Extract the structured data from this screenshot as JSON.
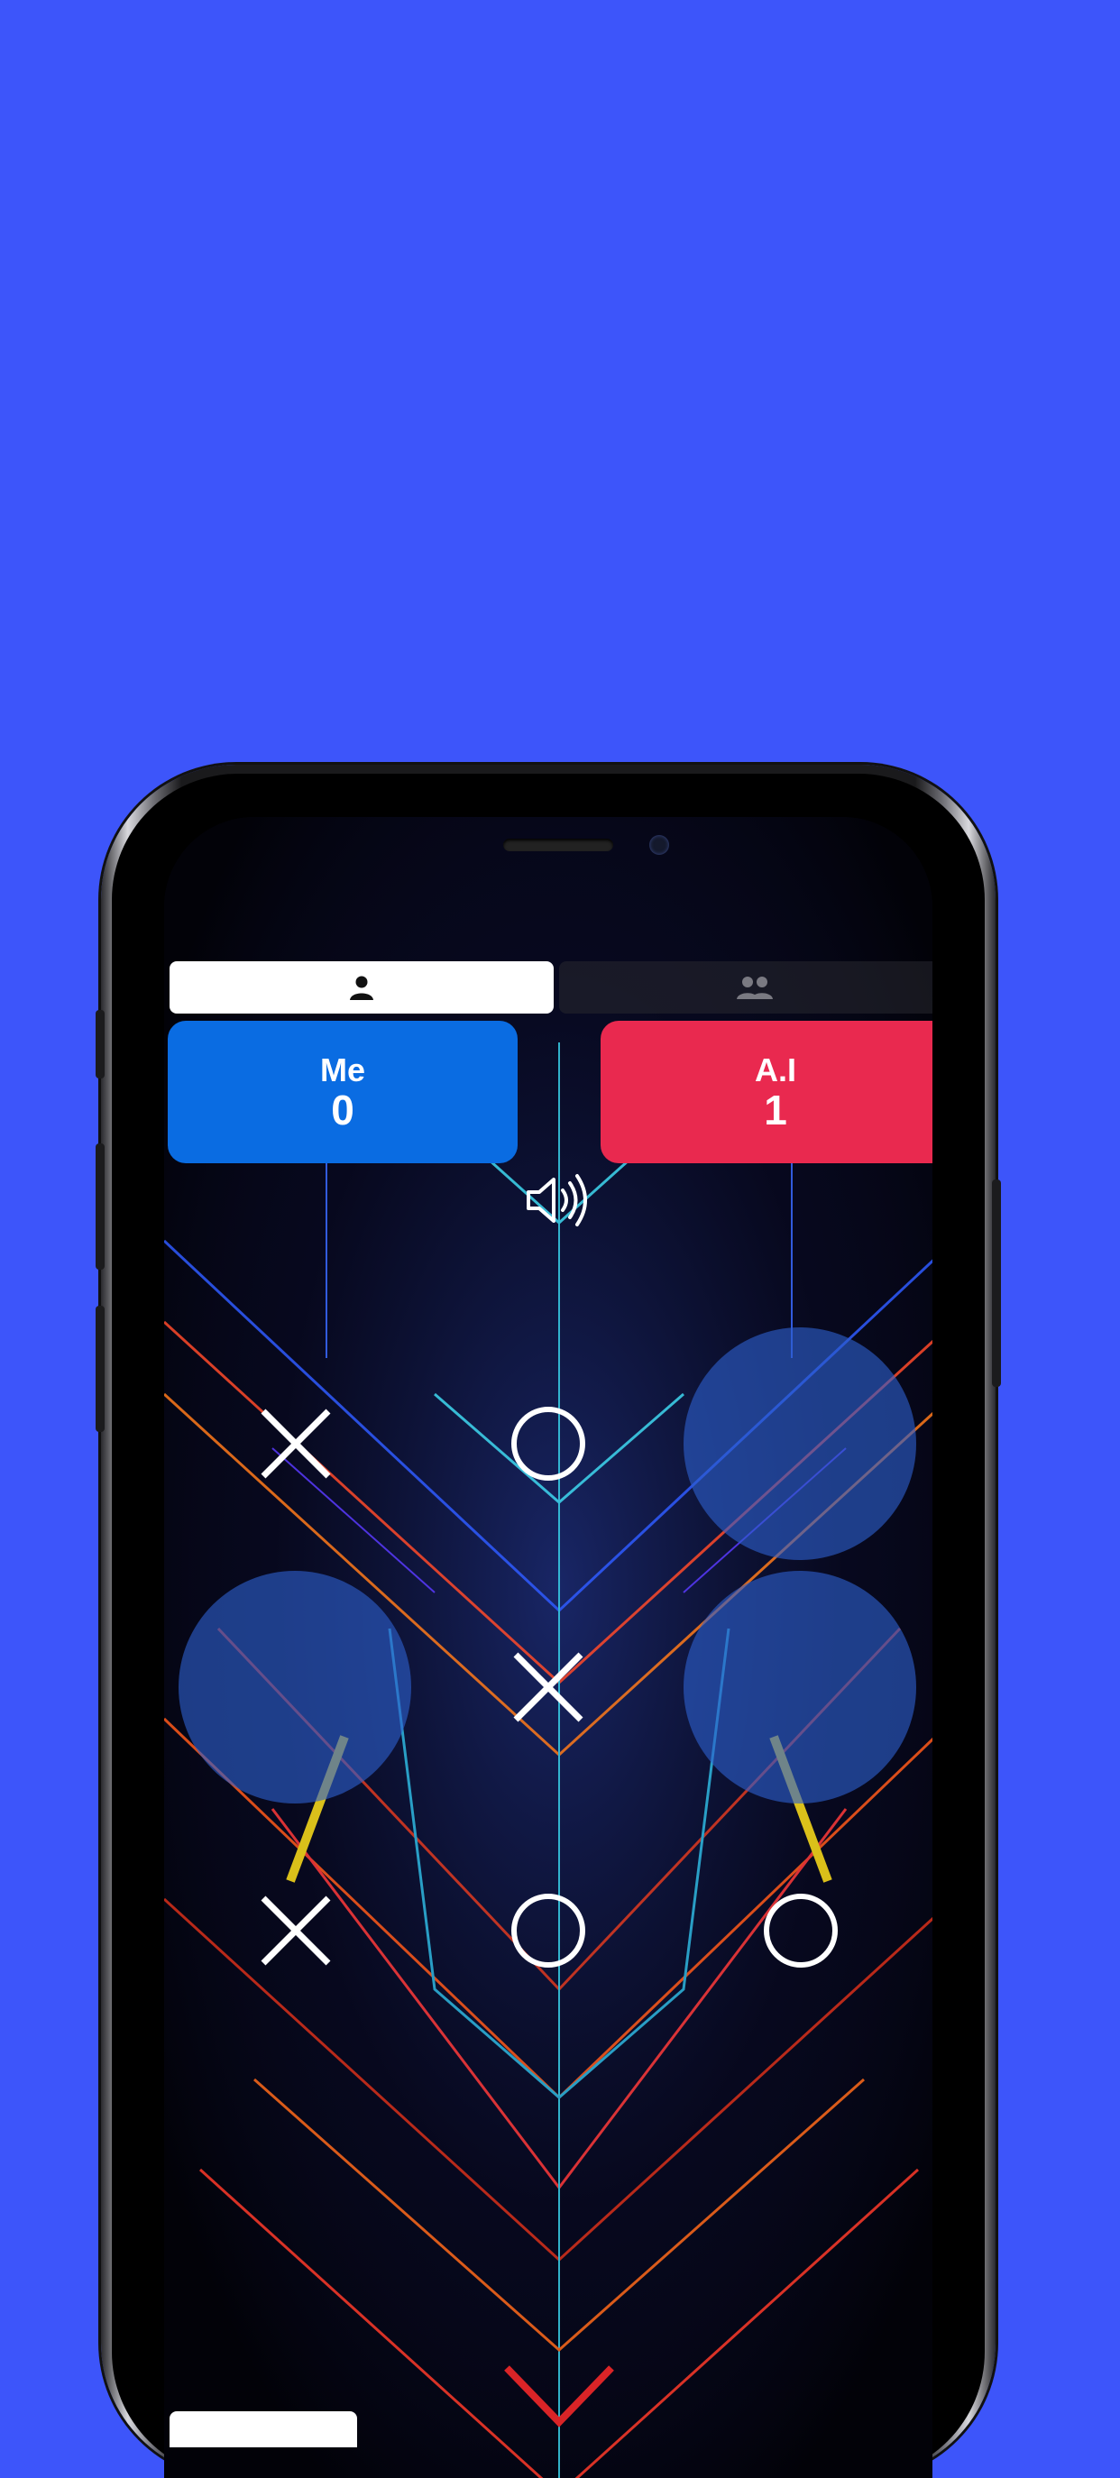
{
  "game": {
    "mode_tabs": [
      {
        "icon": "single-player-icon",
        "selected": true
      },
      {
        "icon": "multi-player-icon",
        "selected": false
      }
    ],
    "scores": {
      "player": {
        "label": "Me",
        "value": "0"
      },
      "opponent": {
        "label": "A.I",
        "value": "1"
      }
    },
    "sound_icon": "speaker-sound-on-icon",
    "board": [
      [
        "X",
        "O",
        ""
      ],
      [
        "",
        "X",
        ""
      ],
      [
        "X",
        "O",
        "O"
      ]
    ],
    "highlighted_cells": [
      [
        0,
        2
      ],
      [
        1,
        0
      ],
      [
        1,
        2
      ]
    ]
  },
  "colors": {
    "page_background": "#3d55fa",
    "player_card": "#0a6ce2",
    "opponent_card": "#e9294f",
    "mark": "#ffffff",
    "highlight": "#2d5fcd"
  }
}
